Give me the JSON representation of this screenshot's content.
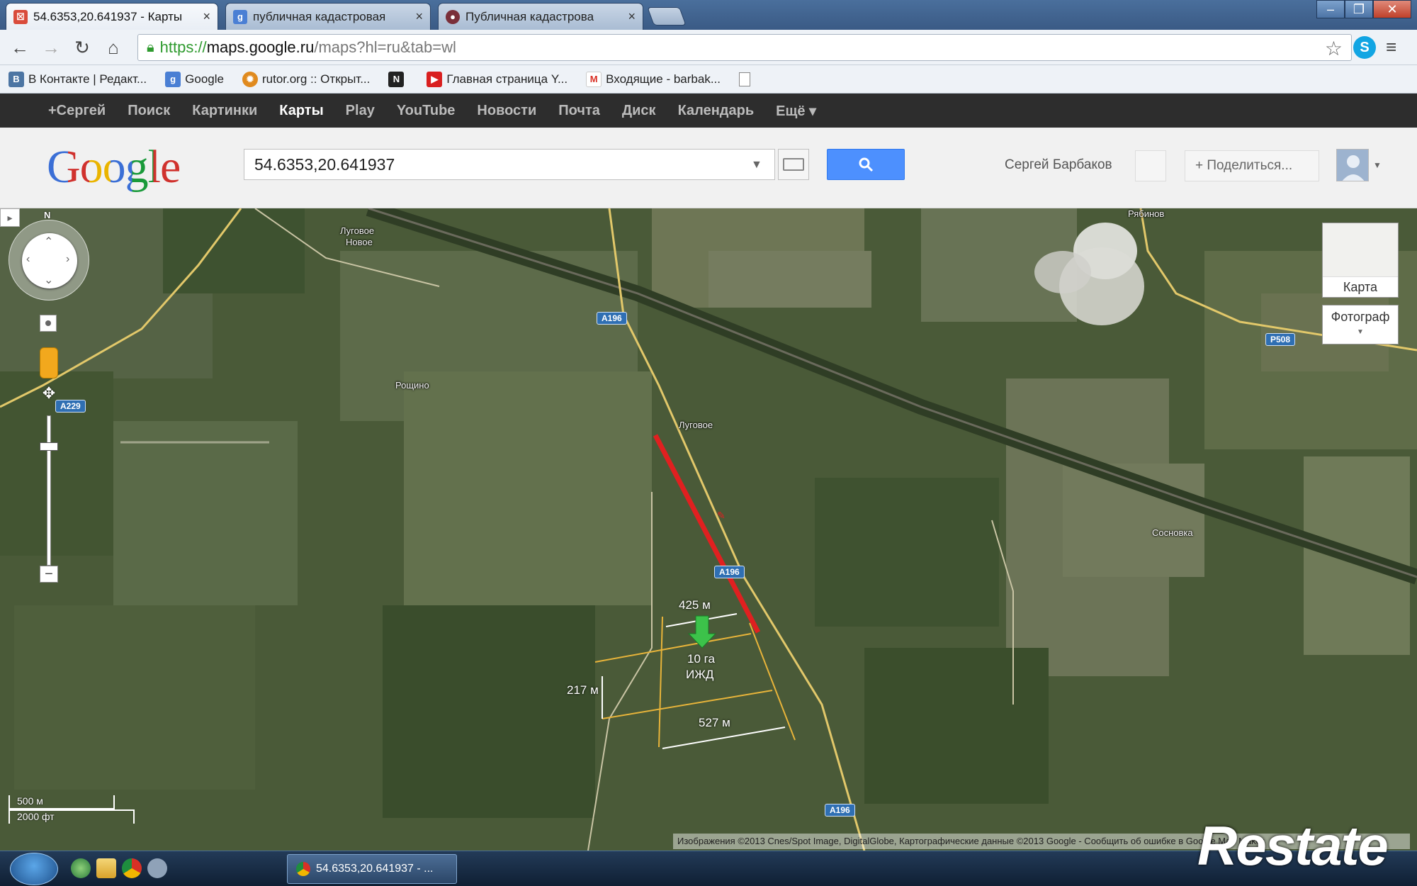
{
  "tabs": [
    {
      "label": "54.6353,20.641937 - Карты",
      "active": true
    },
    {
      "label": "публичная кадастровая",
      "active": false
    },
    {
      "label": "Публичная кадастрова",
      "active": false
    }
  ],
  "toolbar": {
    "url_scheme": "https://",
    "url_host": "maps.google.ru",
    "url_path": "/maps?hl=ru&tab=wl"
  },
  "bookmarks": [
    {
      "label": "В Контакте | Редакт..."
    },
    {
      "label": "Google"
    },
    {
      "label": "rutor.org :: Открыт..."
    },
    {
      "label": "Главная страница Y..."
    },
    {
      "label": "Входящие - barbak..."
    }
  ],
  "google_nav": [
    "+Сергей",
    "Поиск",
    "Картинки",
    "Карты",
    "Play",
    "YouTube",
    "Новости",
    "Почта",
    "Диск",
    "Календарь",
    "Ещё ▾"
  ],
  "google_nav_active": "Карты",
  "header": {
    "logo": "Google",
    "search_value": "54.6353,20.641937",
    "user_name": "Сергей Барбаков",
    "share_label": "+ Поделиться..."
  },
  "map": {
    "place_labels": {
      "lugovoe_novoe_1": "Луговое",
      "lugovoe_novoe_2": "Новое",
      "roshchino": "Рощино",
      "lugovoe": "Луговое",
      "sosnovka": "Сосновка",
      "ryabinovo": "Рябинов"
    },
    "road_shields": {
      "a196_top": "A196",
      "a229": "A229",
      "r508": "P508",
      "a196_mid": "A196",
      "a196_bottom": "A196"
    },
    "annotations": {
      "top_width": "425 м",
      "area": "10 га",
      "purpose": "ИЖД",
      "left_height": "217 м",
      "bottom_width": "527 м"
    },
    "map_types": {
      "map": "Карта",
      "satellite": "Фотограф"
    },
    "scale": {
      "metric": "500 м",
      "imperial": "2000 фт"
    },
    "attribution": "Изображения ©2013 Cnes/Spot Image, DigitalGlobe, Картографические данные ©2013 Google - Сообщить об ошибке в Google  Map Maker",
    "compass_north": "N"
  },
  "taskbar": {
    "active_window": "54.6353,20.641937 - ...",
    "watermark": "Restate"
  },
  "colors": {
    "google_blue": "#4d90fe",
    "route_red": "#e02020",
    "plot_lines": "#e8b43a",
    "road_shield": "#2f6fb3"
  }
}
